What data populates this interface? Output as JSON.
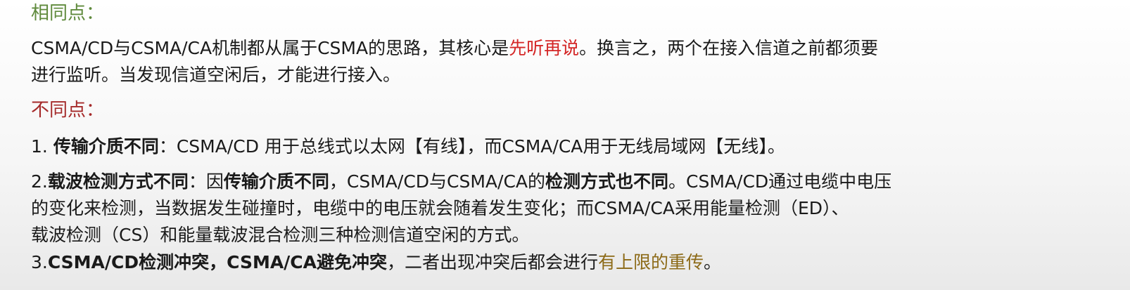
{
  "same": {
    "heading": "相同点：",
    "line1_a": "CSMA/CD与CSMA/CA机制都从属于CSMA的思路，其核心是",
    "line1_highlight": "先听再说",
    "line1_b": "。换言之，两个在接入信道之前都须要",
    "line2": "进行监听。当发现信道空闲后，才能进行接入。"
  },
  "diff": {
    "heading": "不同点：",
    "item1": {
      "number": "1. ",
      "title": "传输介质不同",
      "text": "：CSMA/CD 用于总线式以太网【有线】，而CSMA/CA用于无线局域网【无线】。"
    },
    "item2": {
      "number": "2.",
      "title": "载波检测方式不同",
      "text_a": "：因",
      "bold_a": "传输介质不同",
      "text_b": "，CSMA/CD与CSMA/CA的",
      "bold_b": "检测方式也不同",
      "text_c": "。CSMA/CD通过电缆中电压",
      "line2": "的变化来检测，当数据发生碰撞时，电缆中的电压就会随着发生变化；而CSMA/CA采用能量检测（ED）、",
      "line3": "载波检测（CS）和能量载波混合检测三种检测信道空闲的方式。"
    },
    "item3": {
      "number": "3.",
      "bold_a": "CSMA/CD检测冲突，CSMA/CA避免冲突",
      "text_a": "，二者出现冲突后都会进行",
      "highlight": "有上限的重传",
      "text_b": "。"
    }
  }
}
